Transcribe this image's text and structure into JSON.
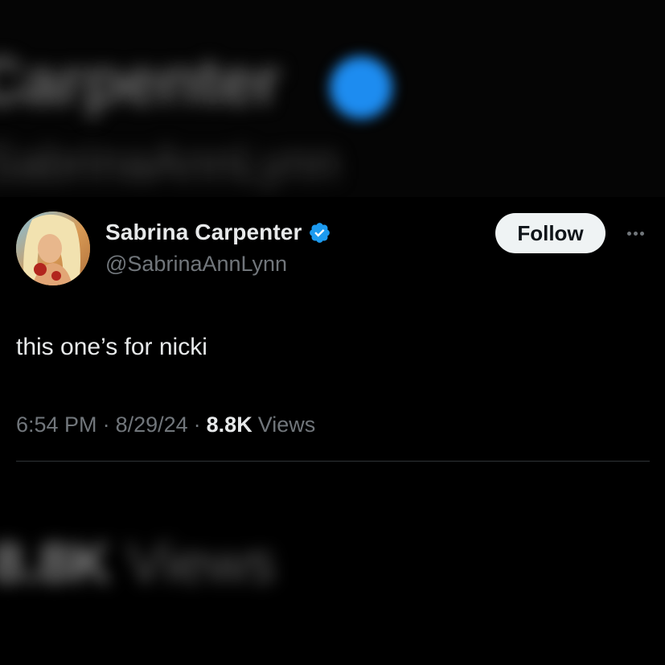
{
  "background": {
    "top_blurred_name": "Carpenter",
    "top_blurred_handle": "SabrinaAnnLynn",
    "bottom_blurred_views_count": "8.8K",
    "bottom_blurred_views_label": "Views"
  },
  "tweet": {
    "display_name": "Sabrina Carpenter",
    "handle": "@SabrinaAnnLynn",
    "verified": true,
    "follow_label": "Follow",
    "text": "this one’s for nicki",
    "time": "6:54 PM",
    "separator": "·",
    "date": "8/29/24",
    "views_count": "8.8K",
    "views_label": "Views"
  },
  "colors": {
    "background": "#000000",
    "primary_text": "#e7e9ea",
    "secondary_text": "#71767b",
    "verified_badge": "#1d9bf0",
    "follow_button_bg": "#eff3f4",
    "divider": "#2f3336"
  },
  "icons": {
    "verified": "verified-badge-icon",
    "more": "more-options-icon"
  }
}
